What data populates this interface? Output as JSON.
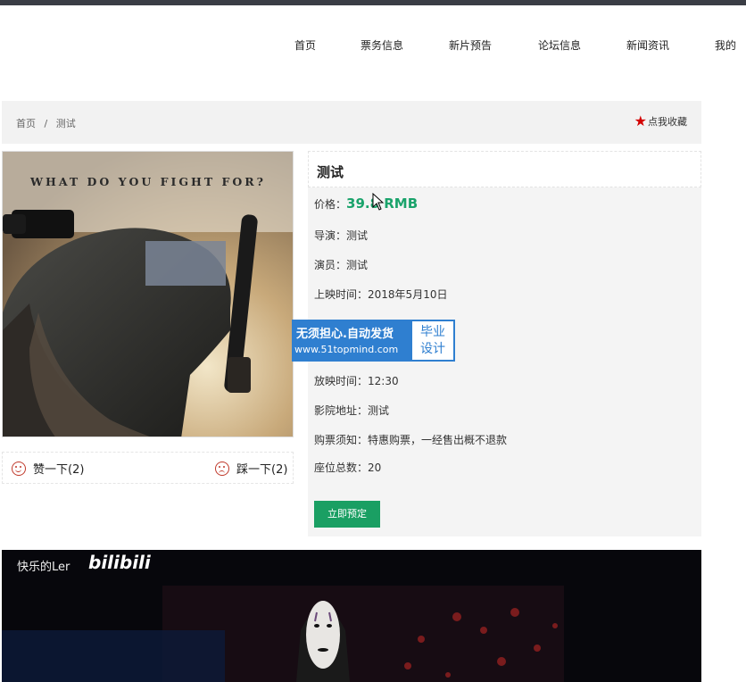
{
  "nav": {
    "items": [
      {
        "label": "首页"
      },
      {
        "label": "票务信息"
      },
      {
        "label": "新片预告"
      },
      {
        "label": "论坛信息"
      },
      {
        "label": "新闻资讯"
      },
      {
        "label": "我的"
      }
    ]
  },
  "breadcrumb": {
    "home": "首页",
    "separator": "/",
    "current": "测试",
    "favorite": "点我收藏"
  },
  "poster": {
    "tagline": "WHAT DO YOU FIGHT FOR?"
  },
  "votes": {
    "like": "赞一下(2)",
    "dislike": "踩一下(2)"
  },
  "movie": {
    "title": "测试",
    "price_label": "价格：",
    "price_value": "39.8 RMB",
    "director_label": "导演：",
    "director": "测试",
    "actor_label": "演员：",
    "actor": "测试",
    "release_label": "上映时间：",
    "release": "2018年5月10日",
    "showtime_label": "放映时间：",
    "showtime": "12:30",
    "cinema_label": "影院地址：",
    "cinema": "测试",
    "notice_label": "购票须知：",
    "notice": "特惠购票，一经售出概不退款",
    "seats_label": "座位总数：",
    "seats": "20",
    "book_button": "立即预定"
  },
  "watermark": {
    "line1": "无须担心.自动发货",
    "line2": "www.51topmind.com",
    "badge_top": "毕业",
    "badge_bottom": "设计"
  },
  "video": {
    "channel": "快乐的Ler",
    "logo": "bilibili"
  },
  "colors": {
    "accent_green": "#1a9f63",
    "star_red": "#d30000",
    "watermark_blue": "#2f7fd0"
  }
}
